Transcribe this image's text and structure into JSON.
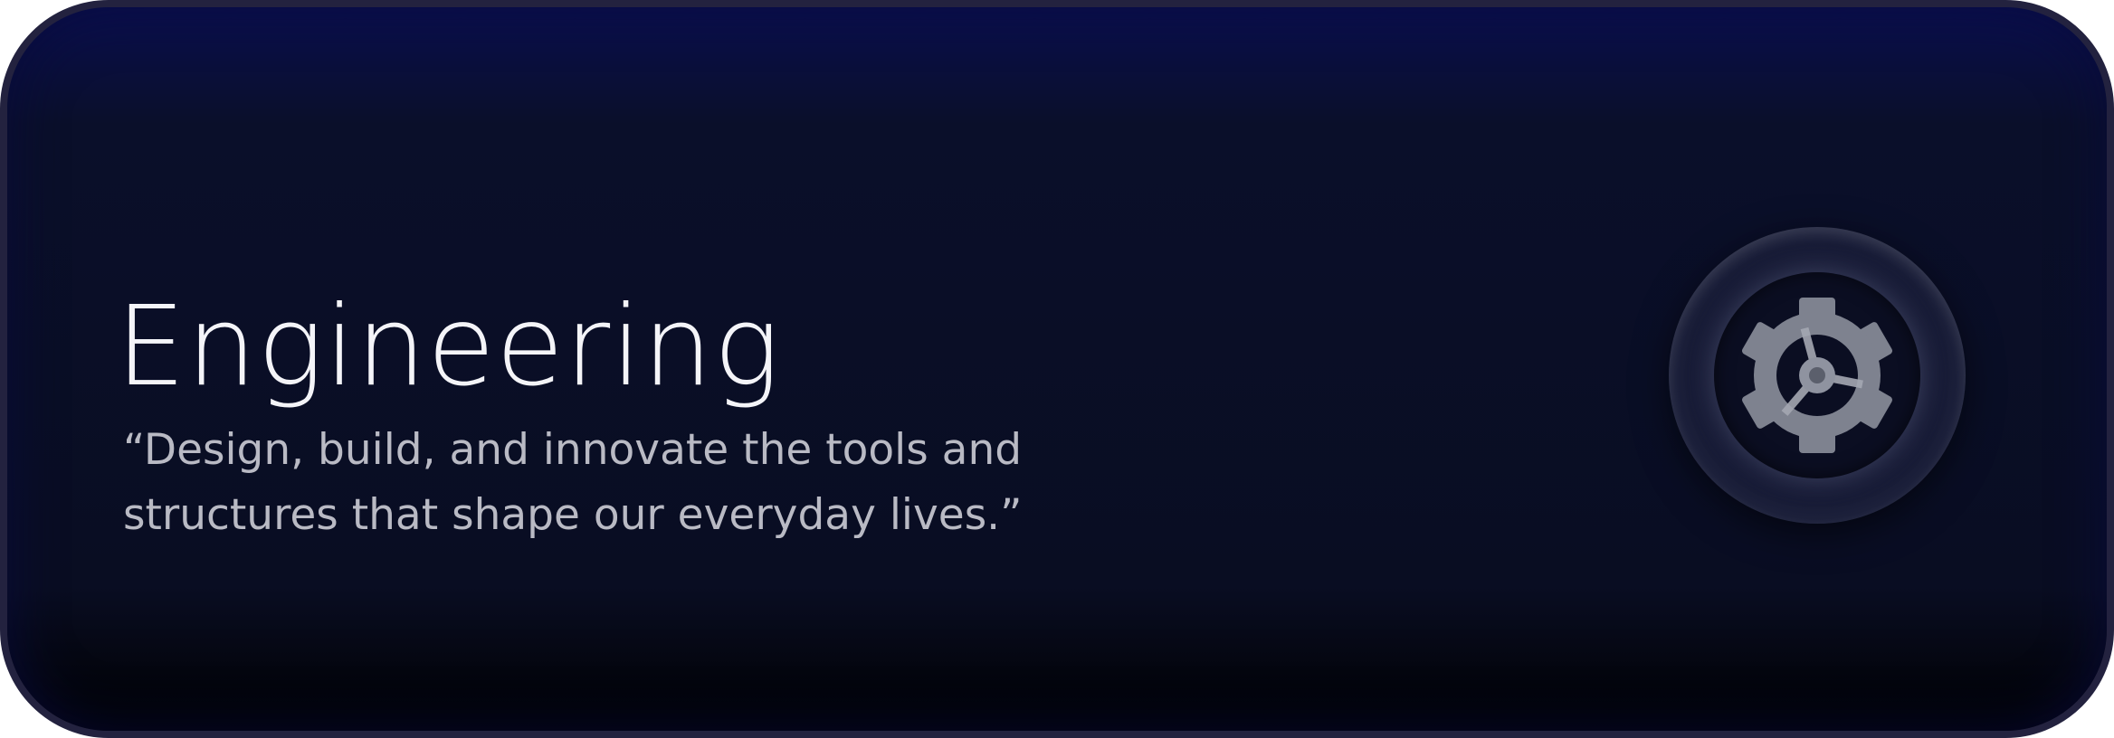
{
  "card": {
    "title": "Engineering",
    "quote": "“Design, build, and innovate the tools and structures that shape our everyday lives.”",
    "icon": "gear-icon"
  },
  "colors": {
    "background_top": "#0a0f4e",
    "background_mid": "#090d22",
    "background_bottom": "#000000",
    "border": "#23223f",
    "title_text": "#f4f4f8",
    "quote_text": "#b9bac4",
    "icon_fill": "#7e828f"
  }
}
